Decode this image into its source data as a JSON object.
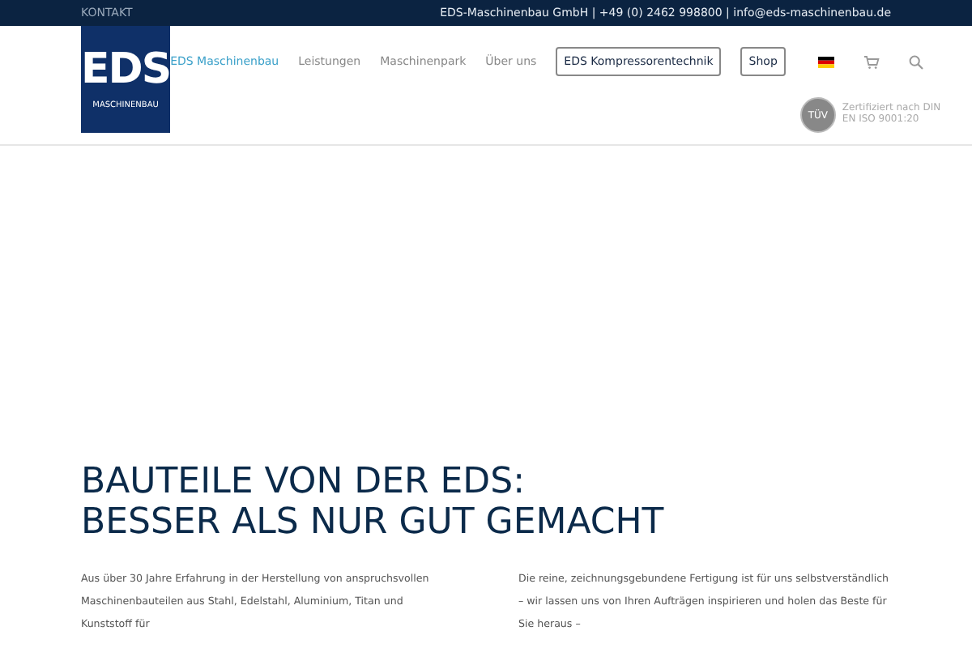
{
  "top_bar": {
    "link": "KONTAKT",
    "contact": "EDS-Maschinenbau GmbH | +49 (0) 2462 998800 | info@eds-maschinenbau.de"
  },
  "logo": {
    "title": "EDS",
    "subtitle": "MASCHINENBAU"
  },
  "nav": [
    {
      "label": "EDS Maschinenbau",
      "kind": "link",
      "selected": true
    },
    {
      "label": "Leistungen",
      "kind": "link",
      "selected": false
    },
    {
      "label": "Maschinenpark",
      "kind": "link",
      "selected": false
    },
    {
      "label": "Über uns",
      "kind": "link",
      "selected": false
    },
    {
      "label": "EDS Kompressorentechnik",
      "kind": "boxed",
      "selected": false
    },
    {
      "label": "Shop",
      "kind": "boxed",
      "selected": false
    }
  ],
  "certification": {
    "badge": "TÜV",
    "text": "Zertifiziert nach DIN EN ISO 9001:20"
  },
  "headline": [
    "BAUTEILE VON DER EDS:",
    "BESSER ALS NUR GUT GEMACHT"
  ],
  "paragraphs": [
    "Aus über 30 Jahre Erfahrung in der Herstellung von anspruchsvollen Maschinenbauteilen aus Stahl, Edelstahl, Aluminium, Titan und Kunststoff für",
    "Die reine, zeichnungsgebundene Fertigung ist für uns selbstverständlich – wir lassen uns von Ihren Aufträgen inspirieren und holen das Beste für Sie heraus –"
  ]
}
